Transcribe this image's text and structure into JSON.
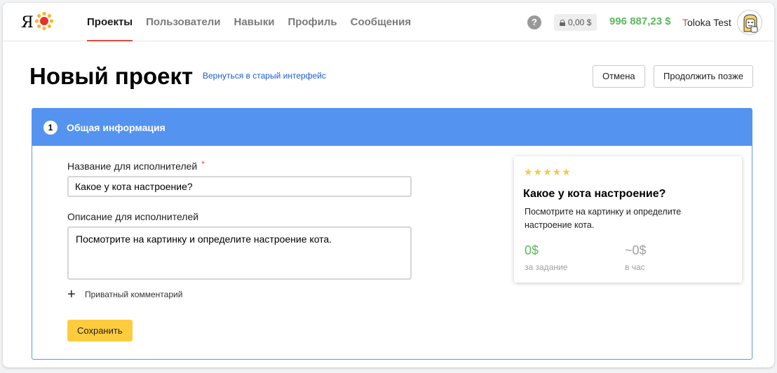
{
  "header": {
    "logo_letter": "Я",
    "nav": [
      {
        "label": "Проекты",
        "active": true
      },
      {
        "label": "Пользователи",
        "active": false
      },
      {
        "label": "Навыки",
        "active": false
      },
      {
        "label": "Профиль",
        "active": false
      },
      {
        "label": "Сообщения",
        "active": false
      }
    ],
    "help": "?",
    "locked_balance": "0,00 $",
    "total_balance": "996 887,23 $",
    "user_initial": "T",
    "user_name_rest": "oloka Test"
  },
  "page": {
    "title": "Новый проект",
    "back_link": "Вернуться в старый интерфейс",
    "cancel_label": "Отмена",
    "later_label": "Продолжить позже"
  },
  "section": {
    "step": "1",
    "title": "Общая информация",
    "name_label": "Название для исполнителей",
    "required_mark": "*",
    "name_value": "Какое у кота настроение?",
    "desc_label": "Описание для исполнителей",
    "desc_value": "Посмотрите на картинку и определите настроение кота.",
    "private_comment_label": "Приватный комментарий",
    "save_label": "Сохранить"
  },
  "preview": {
    "stars": "★★★★★",
    "title": "Какое у кота настроение?",
    "description": "Посмотрите на картинку и определите настроение кота.",
    "price_task": "0$",
    "price_task_caption": "за задание",
    "price_hour": "~0$",
    "price_hour_caption": "в час"
  },
  "colors": {
    "accent_red": "#e2493c",
    "section_blue": "#5493f0",
    "money_green": "#5cb85c",
    "save_yellow": "#fdcc3e"
  }
}
